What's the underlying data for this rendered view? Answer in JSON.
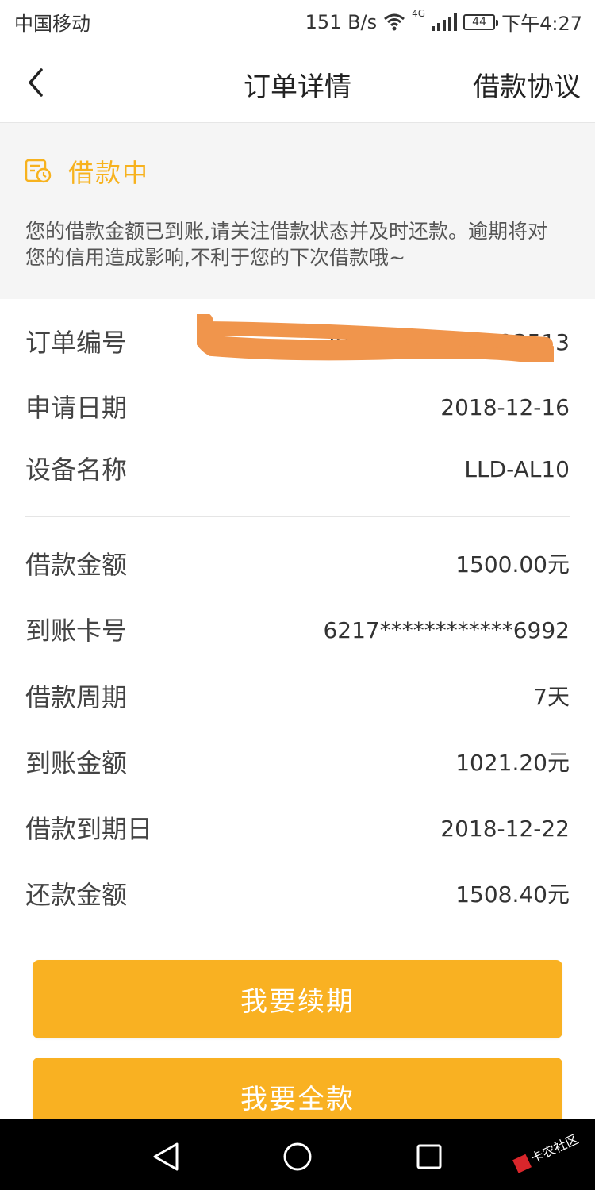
{
  "status_bar": {
    "carrier": "中国移动",
    "speed": "151 B/s",
    "network": "4G",
    "battery": "44",
    "time": "下午4:27"
  },
  "header": {
    "title": "订单详情",
    "agreement": "借款协议",
    "back_icon": "chevron-left-icon"
  },
  "notice": {
    "status": "借款中",
    "status_icon": "calendar-clock-icon",
    "message": "您的借款金额已到账,请关注借款状态并及时还款。逾期将对您的信用造成影响,不利于您的下次借款哦~",
    "accent_color": "#f7b21e"
  },
  "order": {
    "rows_top": [
      {
        "label": "订单编号",
        "value": "201216…4680623513"
      },
      {
        "label": "申请日期",
        "value": "2018-12-16"
      },
      {
        "label": "设备名称",
        "value": "LLD-AL10"
      }
    ],
    "rows_bottom": [
      {
        "label": "借款金额",
        "value": "1500.00元"
      },
      {
        "label": "到账卡号",
        "value": "6217************6992"
      },
      {
        "label": "借款周期",
        "value": "7天"
      },
      {
        "label": "到账金额",
        "value": "1021.20元"
      },
      {
        "label": "借款到期日",
        "value": "2018-12-22"
      },
      {
        "label": "还款金额",
        "value": "1508.40元"
      }
    ]
  },
  "actions": {
    "renew": "我要续期",
    "full_payment": "我要全款",
    "button_color": "#f9b122"
  },
  "nav": {
    "back": "back-triangle-icon",
    "home": "home-circle-icon",
    "recent": "recent-square-icon"
  }
}
